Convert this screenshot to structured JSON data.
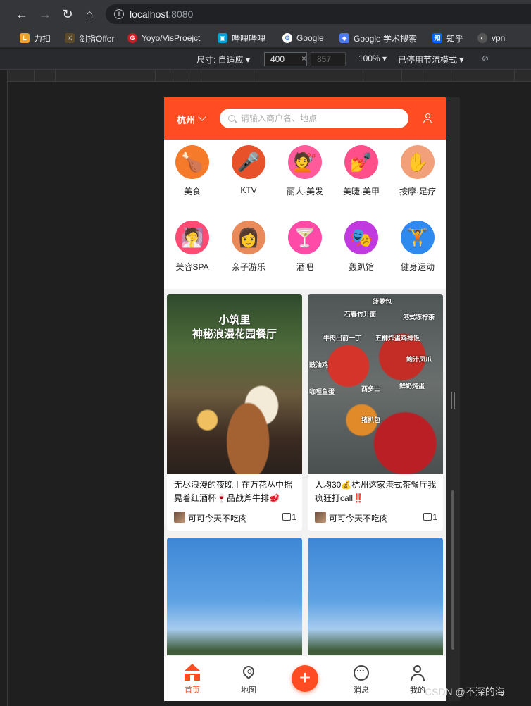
{
  "browser": {
    "url_host": "localhost",
    "url_port": ":8080",
    "bookmarks": [
      {
        "label": "力扣",
        "color": "#f0a22e",
        "glyph": "L"
      },
      {
        "label": "剑指Offer",
        "color": "#d18a2c",
        "glyph": "⚔"
      },
      {
        "label": "Yoyo/VisProejct",
        "color": "#c71d23",
        "glyph": "G"
      },
      {
        "label": "哔哩哔哩",
        "color": "#00a1d6",
        "glyph": "▣"
      },
      {
        "label": "Google",
        "color": "#ffffff",
        "glyph": "G"
      },
      {
        "label": "Google 学术搜索",
        "color": "#4a7cf0",
        "glyph": "◆"
      },
      {
        "label": "知乎",
        "color": "#0066ff",
        "glyph": "知"
      },
      {
        "label": "vpn",
        "color": "#777777",
        "glyph": "◐"
      }
    ]
  },
  "devtools": {
    "size_label": "尺寸: 自适应 ▾",
    "width": "400",
    "height": "857",
    "zoom": "100% ▾",
    "throttle": "已停用节流模式 ▾"
  },
  "app": {
    "city": "杭州",
    "search_placeholder": "请输入商户名、地点",
    "categories": [
      {
        "label": "美食",
        "icon": "🍗",
        "bg": "#f57a2a"
      },
      {
        "label": "KTV",
        "icon": "🎤",
        "bg": "#e8522a"
      },
      {
        "label": "丽人·美发",
        "icon": "💇",
        "bg": "#ff5a9a"
      },
      {
        "label": "美睫·美甲",
        "icon": "💅",
        "bg": "#ff4f8a"
      },
      {
        "label": "按摩·足疗",
        "icon": "✋",
        "bg": "#f2a07a"
      },
      {
        "label": "美容SPA",
        "icon": "🧖",
        "bg": "#ff4b73"
      },
      {
        "label": "亲子游乐",
        "icon": "👩",
        "bg": "#e98a5a"
      },
      {
        "label": "酒吧",
        "icon": "🍸",
        "bg": "#ff4aa8"
      },
      {
        "label": "轰趴馆",
        "icon": "🎭",
        "bg": "#c03ae0"
      },
      {
        "label": "健身运动",
        "icon": "🏋",
        "bg": "#2f8af0"
      }
    ],
    "cards": [
      {
        "title": "无尽浪漫的夜晚丨在万花丛中摇晃着红酒杯🍷品战斧牛排🥩",
        "author": "可可今天不吃肉",
        "likes": "1",
        "overlay_line1": "小筑里",
        "overlay_line2": "神秘浪漫花园餐厅"
      },
      {
        "title": "人均30💰杭州这家港式茶餐厅我疯狂打call‼️",
        "author": "可可今天不吃肉",
        "likes": "1",
        "tags": [
          "菠萝包",
          "石春竹升面",
          "港式冻柠茶",
          "牛肉出前一丁",
          "五柳炸蛋鸡排饭",
          "豉油鸡",
          "鲍汁凤爪",
          "西多士",
          "咖喱鱼蛋",
          "鲜奶炖蛋",
          "猪扒包"
        ]
      },
      {
        "title": "",
        "author": "",
        "likes": ""
      },
      {
        "title": "",
        "author": "",
        "likes": ""
      }
    ],
    "tabs": [
      {
        "label": "首页"
      },
      {
        "label": "地图"
      },
      {
        "label": ""
      },
      {
        "label": "消息"
      },
      {
        "label": "我的"
      }
    ]
  },
  "watermark": "CSDN @不深的海"
}
